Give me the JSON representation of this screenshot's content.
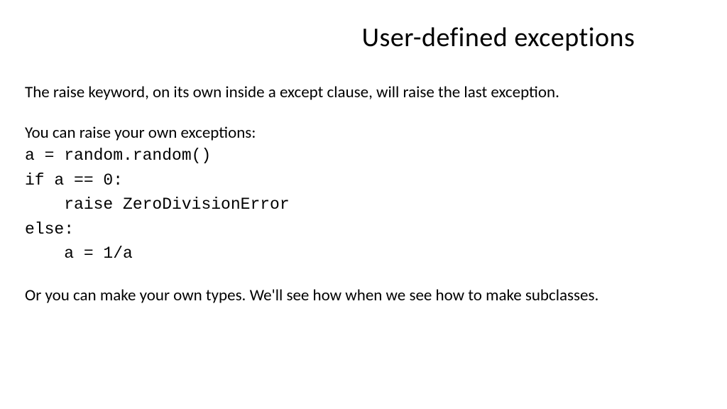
{
  "slide": {
    "title": "User-defined exceptions",
    "paragraph1": "The raise keyword, on its own inside a except clause, will raise the last exception.",
    "paragraph2": "You can raise your own exceptions:",
    "code": "a = random.random()\nif a == 0:\n    raise ZeroDivisionError\nelse:\n    a = 1/a",
    "paragraph3": "Or you can make your own types. We'll see how when we see how to make subclasses."
  }
}
